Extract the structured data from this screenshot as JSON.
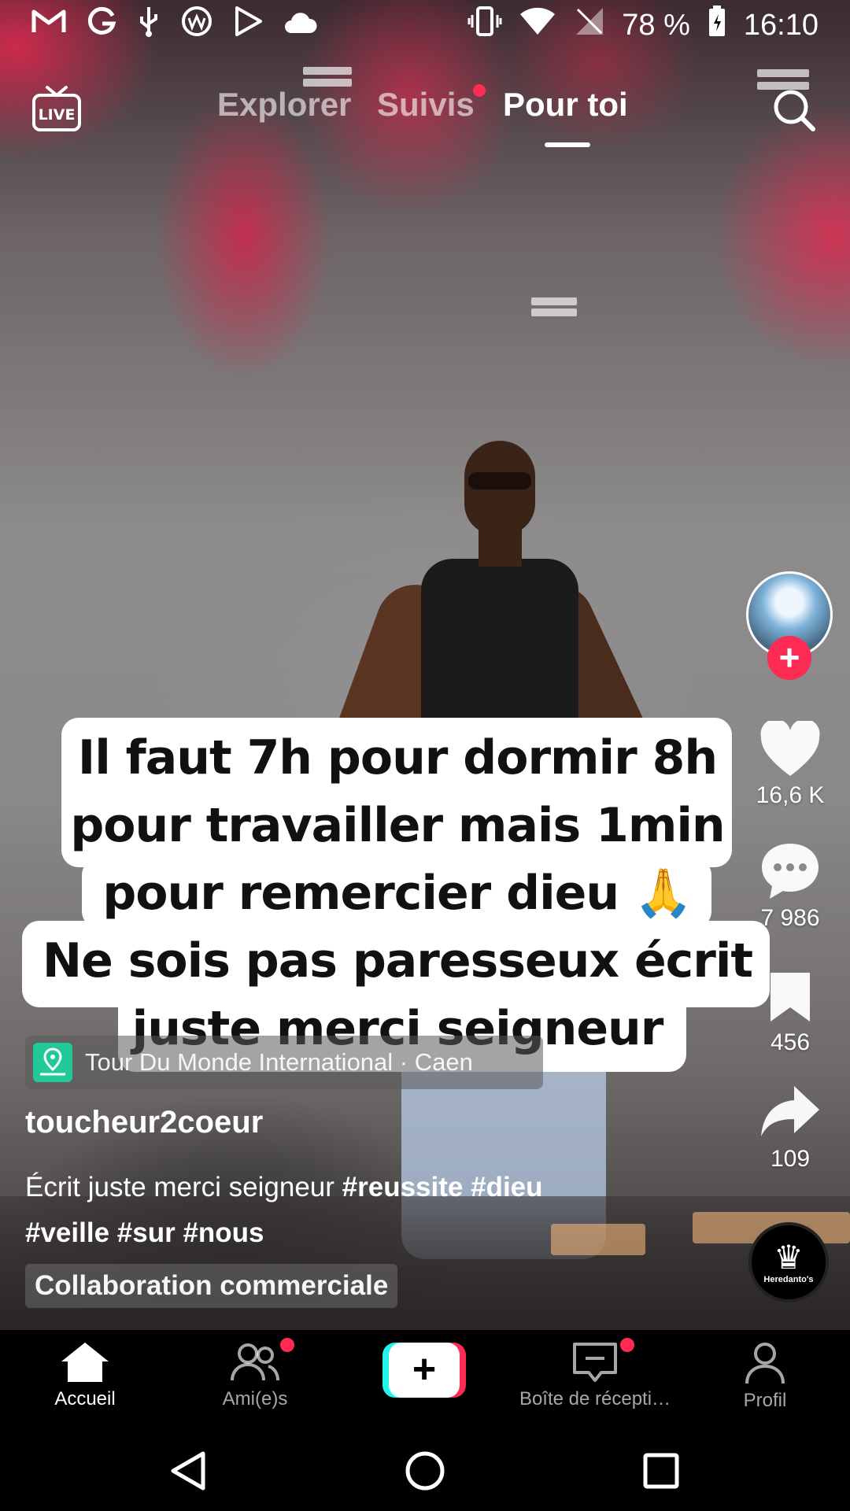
{
  "status_bar": {
    "left_icons": [
      "gmail-icon",
      "google-icon",
      "usb-icon",
      "app-icon",
      "play-store-icon",
      "cloud-icon"
    ],
    "right_icons": [
      "vibrate-icon",
      "wifi-icon",
      "no-signal-icon",
      "battery-charging-icon"
    ],
    "battery": "78 %",
    "time": "16:10"
  },
  "top_nav": {
    "live_label": "LIVE",
    "tabs": [
      {
        "label": "Explorer",
        "active": false
      },
      {
        "label": "Suivis",
        "active": false,
        "dot": true
      },
      {
        "label": "Pour toi",
        "active": true
      }
    ]
  },
  "caption": {
    "lines": [
      "Il faut 7h pour dormir 8h",
      "pour travailler mais 1min",
      "pour remercier dieu 🙏",
      "Ne sois pas paresseux écrit",
      "juste merci seigneur"
    ]
  },
  "right_rail": {
    "likes": "16,6 K",
    "comments": "7 986",
    "saves": "456",
    "shares": "109",
    "music_disc_label": "Heredanto's"
  },
  "post": {
    "location": "Tour Du Monde International · Caen",
    "username": "toucheur2coeur",
    "description_text": "Écrit juste merci seigneur",
    "hashtags_line1": [
      "#reussite",
      "#dieu"
    ],
    "hashtags_line2": [
      "#veille",
      "#sur",
      "#nous"
    ],
    "collab_label": "Collaboration commerciale"
  },
  "bottom_tabs": [
    {
      "label": "Accueil",
      "icon": "home-icon",
      "active": true
    },
    {
      "label": "Ami(e)s",
      "icon": "friends-icon",
      "active": false,
      "dot": true
    },
    {
      "label": "",
      "icon": "create-icon",
      "active": false
    },
    {
      "label": "Boîte de récepti…",
      "icon": "inbox-icon",
      "active": false,
      "dot": true
    },
    {
      "label": "Profil",
      "icon": "profile-icon",
      "active": false
    }
  ],
  "colors": {
    "accent": "#fe2c55",
    "cyan": "#25f4ee",
    "location_chip_icon": "#20c997"
  }
}
